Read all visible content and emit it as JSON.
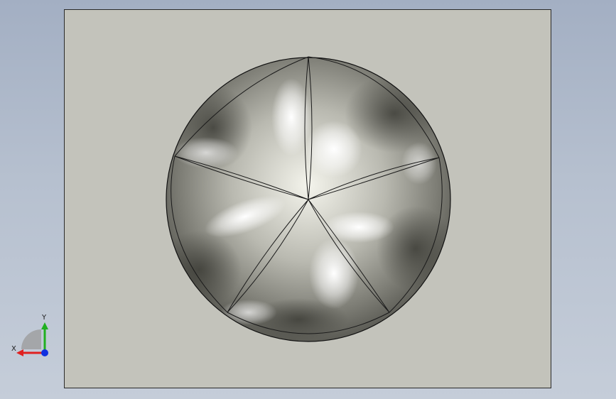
{
  "viewport": {
    "background_top": "#a3afc3",
    "background_bottom": "#c5cdd9",
    "sheet_color": "#c3c3bb"
  },
  "model": {
    "description_icon": "five-panel-domed-shell",
    "panel_count": 5
  },
  "triad": {
    "x_label": "X",
    "y_label": "Y",
    "x_color": "#e02020",
    "y_color": "#20b020",
    "z_color": "#1030e0"
  }
}
